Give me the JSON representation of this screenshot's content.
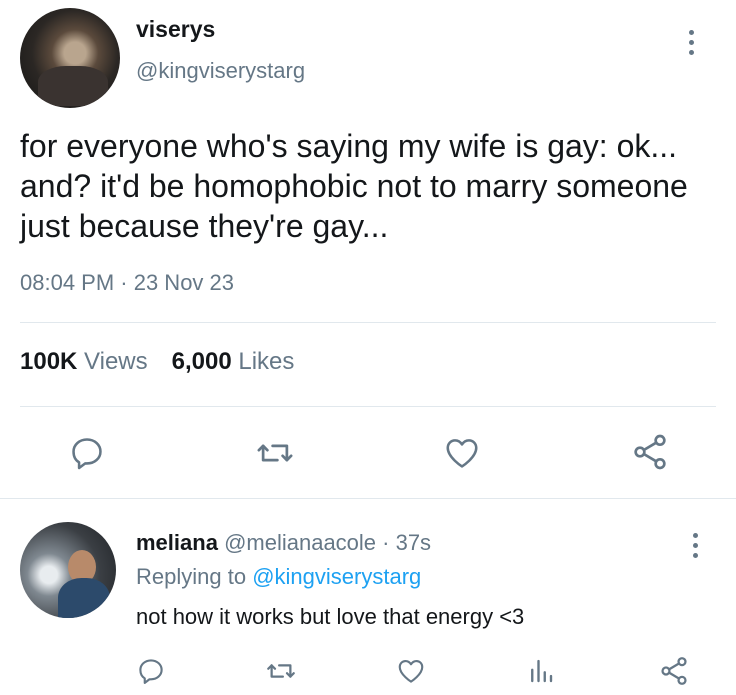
{
  "tweet": {
    "display_name": "viserys",
    "handle": "@kingviserystarg",
    "text": "for everyone who's saying my wife is gay: ok... and? it'd be homophobic not to marry someone just because they're gay...",
    "timestamp": "08:04 PM · 23 Nov 23",
    "views_count": "100K",
    "views_label": "Views",
    "likes_count": "6,000",
    "likes_label": "Likes",
    "actions": [
      "reply-icon",
      "retweet-icon",
      "heart-icon",
      "share-icon"
    ]
  },
  "reply": {
    "display_name": "meliana",
    "handle_time": "@melianaacole · 37s",
    "replying_prefix": "Replying to",
    "replying_to": "@kingviserystarg",
    "text": "not how it works but love that energy <3",
    "actions": [
      "reply-icon",
      "retweet-icon",
      "heart-icon",
      "analytics-icon",
      "share-icon"
    ]
  },
  "colors": {
    "text": "#14171a",
    "secondary": "#657786",
    "accent": "#1da1f2",
    "divider": "#e1e8ed"
  }
}
